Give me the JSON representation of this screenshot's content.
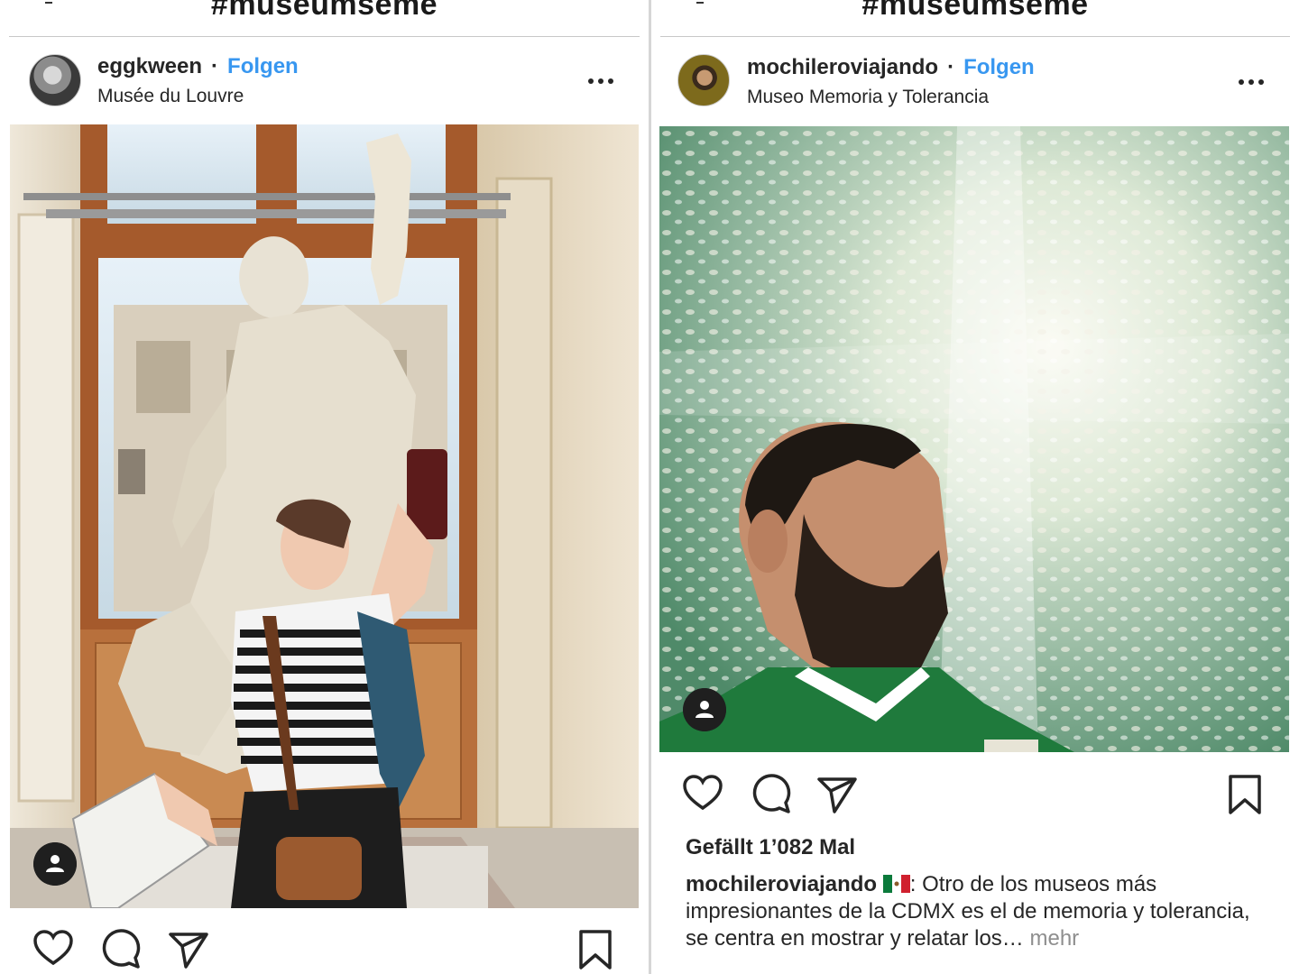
{
  "left_post": {
    "header_tag": "#museumseme",
    "username": "eggkween",
    "separator": "·",
    "follow_label": "Folgen",
    "location": "Musée du Louvre",
    "more_icon": "more-horizontal-icon",
    "user_tag_icon": "user-tag-icon",
    "actions": [
      "heart-icon",
      "comment-icon",
      "share-icon",
      "bookmark-icon"
    ]
  },
  "right_post": {
    "header_tag": "#museumseme",
    "username": "mochileroviajando",
    "separator": "·",
    "follow_label": "Folgen",
    "location": "Museo Memoria y Tolerancia",
    "more_icon": "more-horizontal-icon",
    "user_tag_icon": "user-tag-icon",
    "actions": [
      "heart-icon",
      "comment-icon",
      "share-icon",
      "bookmark-icon"
    ],
    "likes": "Gefällt 1’082 Mal",
    "caption": {
      "username": "mochileroviajando",
      "flag": "mexico-flag-icon",
      "text": ": Otro de los museos más impresionantes de la CDMX es el de memoria y tolerancia, se centra en mostrar y relatar los…",
      "more": " mehr"
    }
  },
  "colors": {
    "link_blue": "#3897f0",
    "text": "#262626",
    "muted": "#8e8e8e"
  }
}
